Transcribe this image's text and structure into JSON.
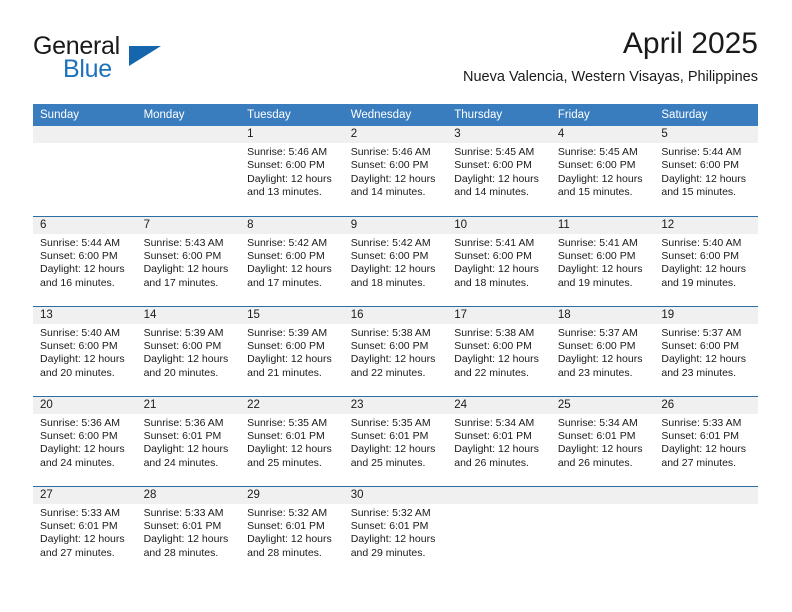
{
  "brand": {
    "name_primary": "General",
    "name_secondary": "Blue",
    "triangle_icon": "triangle-icon",
    "accent_color": "#1d72ba"
  },
  "header": {
    "month_title": "April 2025",
    "location": "Nueva Valencia, Western Visayas, Philippines"
  },
  "theme": {
    "header_bg": "#3a7dbf",
    "row_divider": "#2e6da4",
    "daynum_bg": "#f0f0f0",
    "text": "#1a1a1a"
  },
  "weekday_headers": [
    "Sunday",
    "Monday",
    "Tuesday",
    "Wednesday",
    "Thursday",
    "Friday",
    "Saturday"
  ],
  "labels": {
    "sunrise_prefix": "Sunrise:",
    "sunset_prefix": "Sunset:",
    "daylight_prefix": "Daylight:"
  },
  "weeks": [
    [
      {
        "day": "",
        "sunrise": "",
        "sunset": "",
        "daylight": "",
        "empty": true
      },
      {
        "day": "",
        "sunrise": "",
        "sunset": "",
        "daylight": "",
        "empty": true
      },
      {
        "day": "1",
        "sunrise": "Sunrise: 5:46 AM",
        "sunset": "Sunset: 6:00 PM",
        "daylight": "Daylight: 12 hours and 13 minutes."
      },
      {
        "day": "2",
        "sunrise": "Sunrise: 5:46 AM",
        "sunset": "Sunset: 6:00 PM",
        "daylight": "Daylight: 12 hours and 14 minutes."
      },
      {
        "day": "3",
        "sunrise": "Sunrise: 5:45 AM",
        "sunset": "Sunset: 6:00 PM",
        "daylight": "Daylight: 12 hours and 14 minutes."
      },
      {
        "day": "4",
        "sunrise": "Sunrise: 5:45 AM",
        "sunset": "Sunset: 6:00 PM",
        "daylight": "Daylight: 12 hours and 15 minutes."
      },
      {
        "day": "5",
        "sunrise": "Sunrise: 5:44 AM",
        "sunset": "Sunset: 6:00 PM",
        "daylight": "Daylight: 12 hours and 15 minutes."
      }
    ],
    [
      {
        "day": "6",
        "sunrise": "Sunrise: 5:44 AM",
        "sunset": "Sunset: 6:00 PM",
        "daylight": "Daylight: 12 hours and 16 minutes."
      },
      {
        "day": "7",
        "sunrise": "Sunrise: 5:43 AM",
        "sunset": "Sunset: 6:00 PM",
        "daylight": "Daylight: 12 hours and 17 minutes."
      },
      {
        "day": "8",
        "sunrise": "Sunrise: 5:42 AM",
        "sunset": "Sunset: 6:00 PM",
        "daylight": "Daylight: 12 hours and 17 minutes."
      },
      {
        "day": "9",
        "sunrise": "Sunrise: 5:42 AM",
        "sunset": "Sunset: 6:00 PM",
        "daylight": "Daylight: 12 hours and 18 minutes."
      },
      {
        "day": "10",
        "sunrise": "Sunrise: 5:41 AM",
        "sunset": "Sunset: 6:00 PM",
        "daylight": "Daylight: 12 hours and 18 minutes."
      },
      {
        "day": "11",
        "sunrise": "Sunrise: 5:41 AM",
        "sunset": "Sunset: 6:00 PM",
        "daylight": "Daylight: 12 hours and 19 minutes."
      },
      {
        "day": "12",
        "sunrise": "Sunrise: 5:40 AM",
        "sunset": "Sunset: 6:00 PM",
        "daylight": "Daylight: 12 hours and 19 minutes."
      }
    ],
    [
      {
        "day": "13",
        "sunrise": "Sunrise: 5:40 AM",
        "sunset": "Sunset: 6:00 PM",
        "daylight": "Daylight: 12 hours and 20 minutes."
      },
      {
        "day": "14",
        "sunrise": "Sunrise: 5:39 AM",
        "sunset": "Sunset: 6:00 PM",
        "daylight": "Daylight: 12 hours and 20 minutes."
      },
      {
        "day": "15",
        "sunrise": "Sunrise: 5:39 AM",
        "sunset": "Sunset: 6:00 PM",
        "daylight": "Daylight: 12 hours and 21 minutes."
      },
      {
        "day": "16",
        "sunrise": "Sunrise: 5:38 AM",
        "sunset": "Sunset: 6:00 PM",
        "daylight": "Daylight: 12 hours and 22 minutes."
      },
      {
        "day": "17",
        "sunrise": "Sunrise: 5:38 AM",
        "sunset": "Sunset: 6:00 PM",
        "daylight": "Daylight: 12 hours and 22 minutes."
      },
      {
        "day": "18",
        "sunrise": "Sunrise: 5:37 AM",
        "sunset": "Sunset: 6:00 PM",
        "daylight": "Daylight: 12 hours and 23 minutes."
      },
      {
        "day": "19",
        "sunrise": "Sunrise: 5:37 AM",
        "sunset": "Sunset: 6:00 PM",
        "daylight": "Daylight: 12 hours and 23 minutes."
      }
    ],
    [
      {
        "day": "20",
        "sunrise": "Sunrise: 5:36 AM",
        "sunset": "Sunset: 6:00 PM",
        "daylight": "Daylight: 12 hours and 24 minutes."
      },
      {
        "day": "21",
        "sunrise": "Sunrise: 5:36 AM",
        "sunset": "Sunset: 6:01 PM",
        "daylight": "Daylight: 12 hours and 24 minutes."
      },
      {
        "day": "22",
        "sunrise": "Sunrise: 5:35 AM",
        "sunset": "Sunset: 6:01 PM",
        "daylight": "Daylight: 12 hours and 25 minutes."
      },
      {
        "day": "23",
        "sunrise": "Sunrise: 5:35 AM",
        "sunset": "Sunset: 6:01 PM",
        "daylight": "Daylight: 12 hours and 25 minutes."
      },
      {
        "day": "24",
        "sunrise": "Sunrise: 5:34 AM",
        "sunset": "Sunset: 6:01 PM",
        "daylight": "Daylight: 12 hours and 26 minutes."
      },
      {
        "day": "25",
        "sunrise": "Sunrise: 5:34 AM",
        "sunset": "Sunset: 6:01 PM",
        "daylight": "Daylight: 12 hours and 26 minutes."
      },
      {
        "day": "26",
        "sunrise": "Sunrise: 5:33 AM",
        "sunset": "Sunset: 6:01 PM",
        "daylight": "Daylight: 12 hours and 27 minutes."
      }
    ],
    [
      {
        "day": "27",
        "sunrise": "Sunrise: 5:33 AM",
        "sunset": "Sunset: 6:01 PM",
        "daylight": "Daylight: 12 hours and 27 minutes."
      },
      {
        "day": "28",
        "sunrise": "Sunrise: 5:33 AM",
        "sunset": "Sunset: 6:01 PM",
        "daylight": "Daylight: 12 hours and 28 minutes."
      },
      {
        "day": "29",
        "sunrise": "Sunrise: 5:32 AM",
        "sunset": "Sunset: 6:01 PM",
        "daylight": "Daylight: 12 hours and 28 minutes."
      },
      {
        "day": "30",
        "sunrise": "Sunrise: 5:32 AM",
        "sunset": "Sunset: 6:01 PM",
        "daylight": "Daylight: 12 hours and 29 minutes."
      },
      {
        "day": "",
        "sunrise": "",
        "sunset": "",
        "daylight": "",
        "empty": true
      },
      {
        "day": "",
        "sunrise": "",
        "sunset": "",
        "daylight": "",
        "empty": true
      },
      {
        "day": "",
        "sunrise": "",
        "sunset": "",
        "daylight": "",
        "empty": true
      }
    ]
  ]
}
